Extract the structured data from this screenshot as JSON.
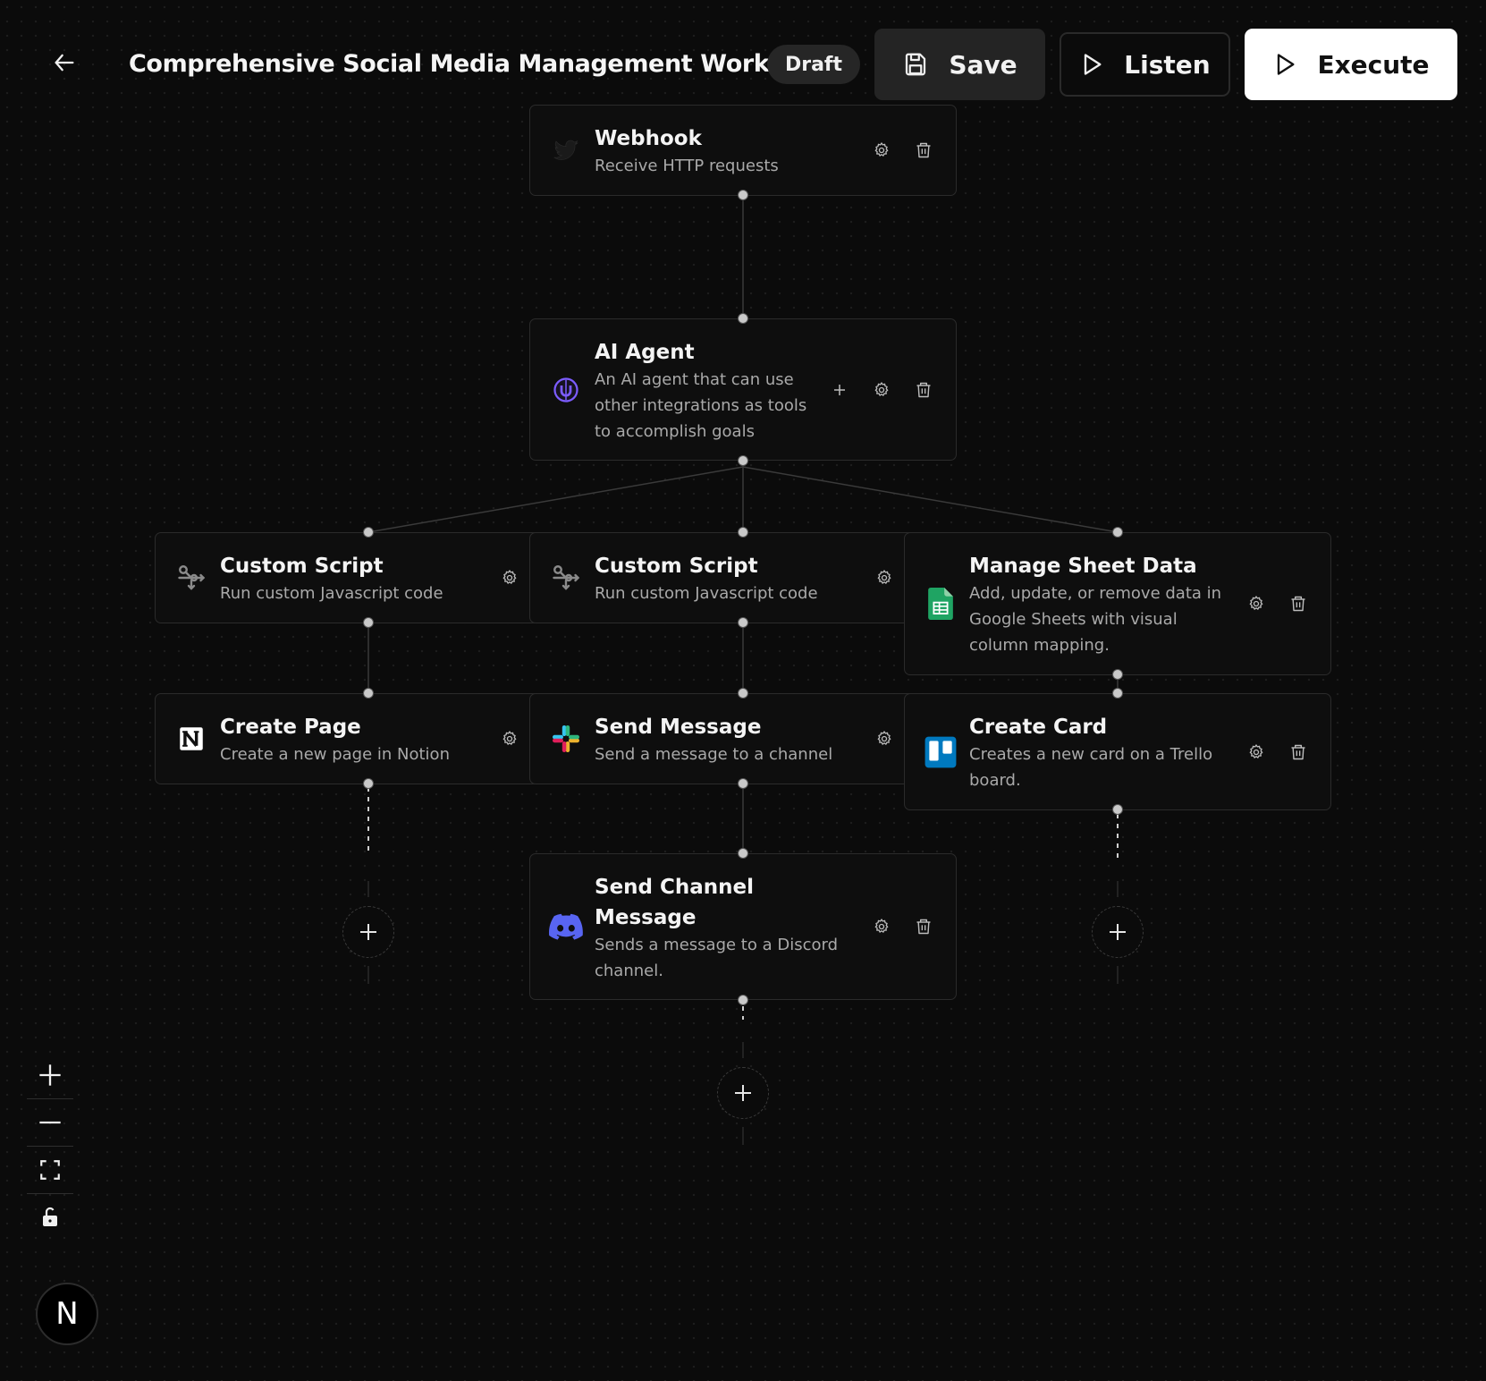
{
  "header": {
    "title": "Comprehensive Social Media Management Workflow",
    "badge": "Draft",
    "save_label": "Save",
    "listen_label": "Listen",
    "execute_label": "Execute"
  },
  "nodes": {
    "webhook": {
      "title": "Webhook",
      "desc": [
        "Receive HTTP requests"
      ],
      "icon": "webhook-icon"
    },
    "ai_agent": {
      "title": "AI Agent",
      "desc": [
        "An AI agent that can use",
        "other integrations as tools",
        "to accomplish goals"
      ],
      "icon": "ai-agent-icon"
    },
    "custom_script_1": {
      "title": "Custom Script",
      "desc": [
        "Run custom Javascript code"
      ],
      "icon": "script-icon"
    },
    "custom_script_2": {
      "title": "Custom Script",
      "desc": [
        "Run custom Javascript code"
      ],
      "icon": "script-icon"
    },
    "manage_sheet": {
      "title": "Manage Sheet Data",
      "desc": [
        "Add, update, or remove data in",
        "Google Sheets with visual",
        "column mapping."
      ],
      "icon": "google-sheets-icon"
    },
    "create_page": {
      "title": "Create Page",
      "desc": [
        "Create a new page in Notion"
      ],
      "icon": "notion-icon"
    },
    "send_message": {
      "title": "Send Message",
      "desc": [
        "Send a message to a channel"
      ],
      "icon": "slack-icon"
    },
    "create_card": {
      "title": "Create Card",
      "desc": [
        "Creates a new card on a Trello",
        "board."
      ],
      "icon": "trello-icon"
    },
    "send_channel": {
      "title": [
        "Send Channel",
        "Message"
      ],
      "desc": [
        "Sends a message to a Discord",
        "channel."
      ],
      "icon": "discord-icon"
    }
  },
  "zoom_controls": [
    "zoom-in-icon",
    "zoom-out-icon",
    "fit-view-icon",
    "lock-icon"
  ],
  "brand": {
    "logo_letter": "N"
  },
  "colors": {
    "background": "#0b0b0b",
    "node_bg": "#0e0e0e",
    "accent_white": "#ffffff",
    "ai_purple": "#7c5cff",
    "sheets_green": "#1fa463",
    "trello_blue": "#0079bf",
    "discord_blurple": "#5865f2"
  }
}
